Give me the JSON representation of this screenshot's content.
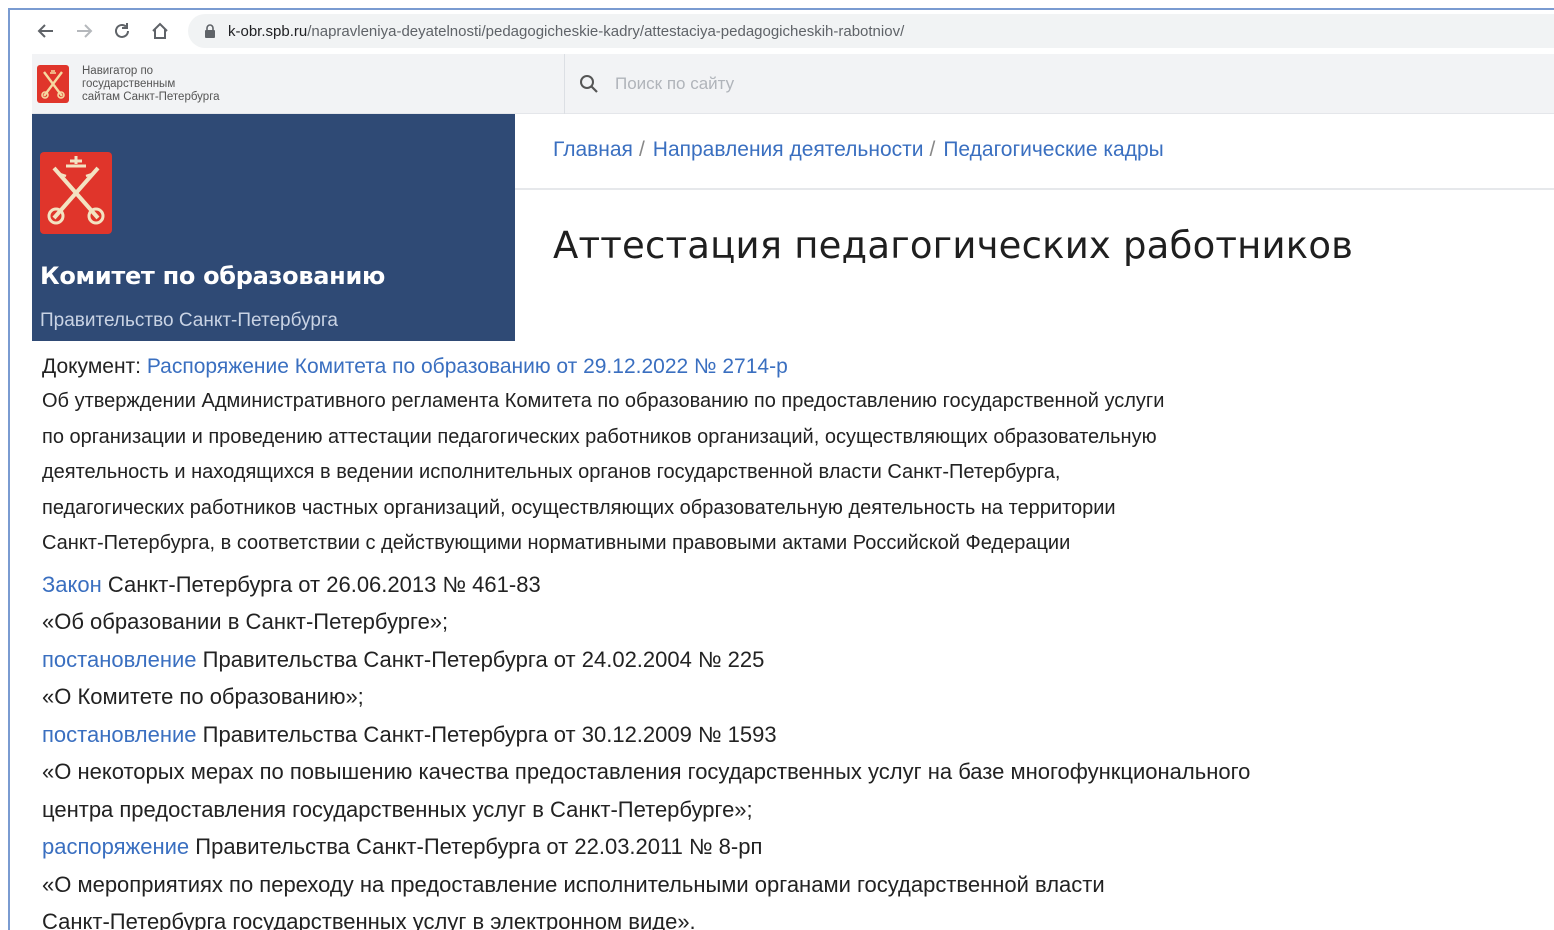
{
  "browser": {
    "url_domain": "k-obr.spb.ru",
    "url_path": "/napravleniya-deyatelnosti/pedagogicheskie-kadry/attestaciya-pedagogicheskih-rabotniov/"
  },
  "portal": {
    "navigator_text_1": "Навигатор по",
    "navigator_text_2": "государственным",
    "navigator_text_3": "сайтам Санкт-Петербурга",
    "search_placeholder": "Поиск по сайту"
  },
  "committee": {
    "name": "Комитет по образованию",
    "government": "Правительство Санкт-Петербурга"
  },
  "breadcrumb": {
    "items": [
      "Главная",
      "Направления деятельности",
      "Педагогические кадры"
    ],
    "separator": "/"
  },
  "page": {
    "title": "Аттестация педагогических работников"
  },
  "document": {
    "label": "Документ:",
    "link": "Распоряжение Комитета по образованию от 29.12.2022 № 2714-р",
    "description_lines": [
      "Об утверждении Административного регламента Комитета по образованию по предоставлению государственной услуги",
      "по организации и проведению аттестации педагогических работников организаций, осуществляющих образовательную",
      "деятельность и находящихся в ведении исполнительных органов государственной власти Санкт-Петербурга,",
      "педагогических работников частных организаций, осуществляющих образовательную деятельность на территории",
      "Санкт-Петербурга, в соответствии с действующими нормативными правовыми актами Российской Федерации"
    ]
  },
  "acts": [
    {
      "link": "Закон",
      "text": " Санкт-Петербурга от 26.06.2013 № 461-83"
    },
    {
      "link": "",
      "text": "«Об образовании в Санкт-Петербурге»;"
    },
    {
      "link": "постановление",
      "text": " Правительства Санкт-Петербурга от 24.02.2004 № 225"
    },
    {
      "link": "",
      "text": "«О Комитете по образованию»;"
    },
    {
      "link": "постановление",
      "text": " Правительства Санкт-Петербурга от 30.12.2009 № 1593"
    },
    {
      "link": "",
      "text": "«О некоторых мерах по повышению качества предоставления государственных услуг на базе многофункционального"
    },
    {
      "link": "",
      "text": "центра предоставления государственных услуг в Санкт-Петербурге»;"
    },
    {
      "link": "распоряжение",
      "text": " Правительства Санкт-Петербурга от 22.03.2011 № 8-рп"
    },
    {
      "link": "",
      "text": "«О мероприятиях по переходу на предоставление исполнительными органами государственной власти"
    },
    {
      "link": "",
      "text": "Санкт-Петербурга государственных услуг в электронном виде»."
    }
  ],
  "colors": {
    "link": "#3a6fc0",
    "committee_bg": "#2f4a75",
    "emblem_red": "#e0352b"
  },
  "icons": [
    "back-arrow-icon",
    "forward-arrow-icon",
    "reload-icon",
    "home-icon",
    "lock-icon",
    "search-icon",
    "spb-emblem-icon"
  ]
}
